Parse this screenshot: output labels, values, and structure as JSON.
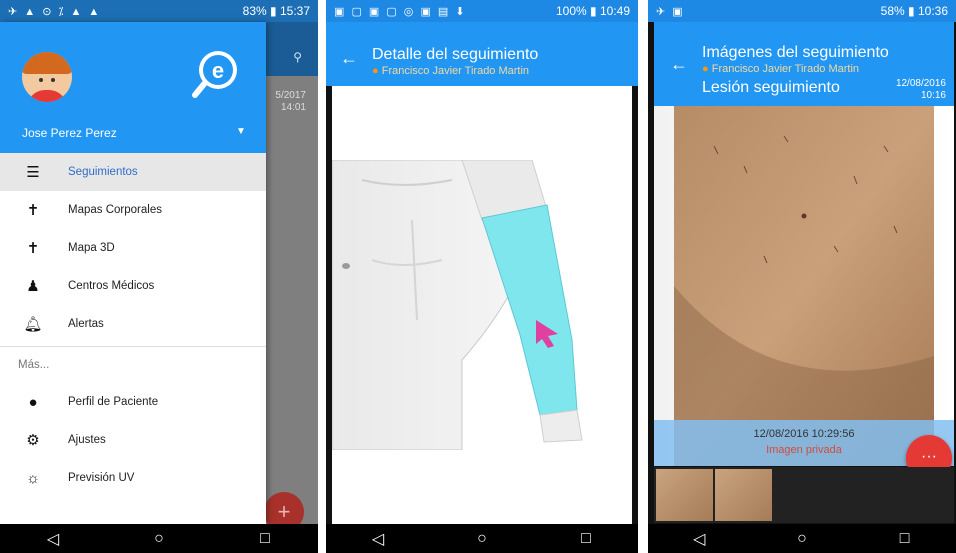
{
  "screen1": {
    "status": {
      "time": "15:37",
      "battery": "83%"
    },
    "username": "Jose Perez Perez",
    "menu": [
      {
        "label": "Seguimientos",
        "icon": "list-icon"
      },
      {
        "label": "Mapas Corporales",
        "icon": "person-icon"
      },
      {
        "label": "Mapa 3D",
        "icon": "person-icon"
      },
      {
        "label": "Centros Médicos",
        "icon": "doctor-icon"
      },
      {
        "label": "Alertas",
        "icon": "bell-icon"
      }
    ],
    "more_label": "Más...",
    "more_menu": [
      {
        "label": "Perfil de Paciente",
        "icon": "profile-icon"
      },
      {
        "label": "Ajustes",
        "icon": "gear-icon"
      },
      {
        "label": "Previsión UV",
        "icon": "sun-icon"
      }
    ],
    "background_date": "5/2017",
    "background_time": "14:01",
    "fab": "+"
  },
  "screen2": {
    "status": {
      "time": "10:49",
      "battery": "100%"
    },
    "title": "Detalle del seguimiento",
    "subtitle": "Francisco Javier Tirado Martin"
  },
  "screen3": {
    "status": {
      "time": "10:36",
      "battery": "58%"
    },
    "title": "Imágenes del seguimiento",
    "subtitle": "Francisco Javier Tirado Martin",
    "lesion": "Lesión seguimiento",
    "date": "12/08/2016",
    "time": "10:16",
    "caption_timestamp": "12/08/2016 10:29:56",
    "caption_private": "Imagen privada",
    "fab": "···"
  },
  "colors": {
    "primary": "#2196f3",
    "accent_red": "#e53935",
    "highlight_cyan": "#7fe6ee"
  }
}
